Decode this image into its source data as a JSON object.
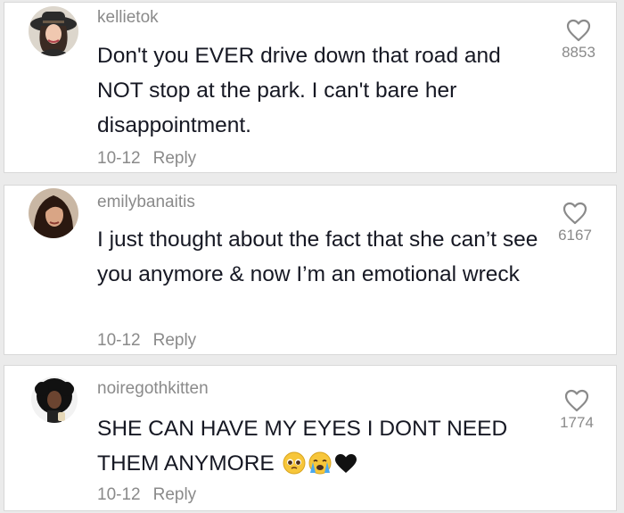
{
  "comments": [
    {
      "username": "kellietok",
      "text": "Don't you EVER drive down that road and NOT stop at the park. I can't bare her disappointment.",
      "date": "10-12",
      "reply": "Reply",
      "likes": "8853",
      "avatar": "woman-with-hat-avatar"
    },
    {
      "username": "emilybanaitis",
      "text": "I just thought about the fact that she can’t see you anymore & now I’m an emotional wreck",
      "date": "10-12",
      "reply": "Reply",
      "likes": "6167",
      "avatar": "woman-long-hair-avatar"
    },
    {
      "username": "noiregothkitten",
      "text": "SHE CAN HAVE MY EYES I DONT NEED THEM ANYMORE",
      "date": "10-12",
      "reply": "Reply",
      "likes": "1774",
      "avatar": "curly-hair-avatar",
      "emojis": [
        "pleading-face-emoji",
        "crying-face-emoji",
        "black-heart-emoji"
      ]
    }
  ],
  "colors": {
    "muted": "#8a8a8a",
    "text": "#161823",
    "background": "#ebebeb"
  }
}
